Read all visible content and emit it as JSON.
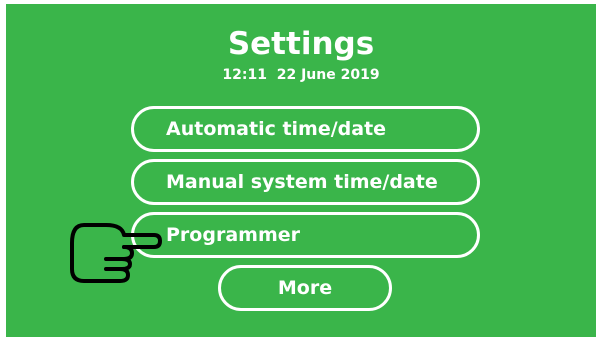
{
  "header": {
    "title": "Settings",
    "datetime": "12:11  22 June 2019"
  },
  "menu": {
    "items": [
      {
        "label": "Automatic time/date"
      },
      {
        "label": "Manual system time/date"
      },
      {
        "label": "Programmer"
      }
    ],
    "more_label": "More"
  },
  "pointer_icon": "pointing-hand-icon",
  "colors": {
    "background": "#3ab54a",
    "text": "#ffffff",
    "outline": "#ffffff",
    "pointer": "#000000"
  }
}
